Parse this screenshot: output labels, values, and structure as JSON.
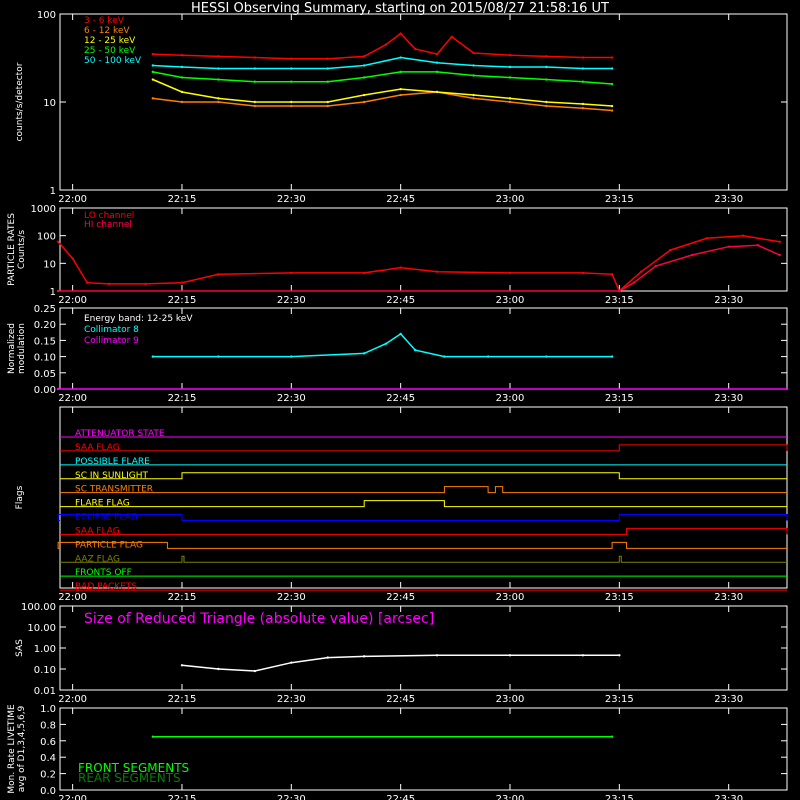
{
  "title": "HESSI Observing Summary, starting on 2015/08/27 21:58:16 UT",
  "time_ticks": [
    "22:00",
    "22:15",
    "22:30",
    "22:45",
    "23:00",
    "23:15",
    "23:30"
  ],
  "chart_data": [
    {
      "type": "line",
      "id": "count-rates",
      "ylabel": "counts/s/detector",
      "yscale": "log",
      "ylim": [
        1,
        100
      ],
      "ytick_labels": [
        "1",
        "10",
        "100"
      ],
      "x_range": [
        "21:58:16",
        "23:38:00"
      ],
      "series": [
        {
          "name": "3 - 6 keV",
          "color": "#ff0000",
          "x": [
            "22:11",
            "22:15",
            "22:20",
            "22:25",
            "22:30",
            "22:35",
            "22:40",
            "22:43",
            "22:45",
            "22:47",
            "22:50",
            "22:52",
            "22:55",
            "23:00",
            "23:05",
            "23:10",
            "23:14"
          ],
          "values": [
            35,
            34,
            33,
            32,
            31,
            31,
            33,
            45,
            60,
            40,
            35,
            55,
            36,
            34,
            33,
            32,
            32
          ]
        },
        {
          "name": "6 - 12 keV",
          "color": "#ff8000",
          "x": [
            "22:11",
            "22:15",
            "22:20",
            "22:25",
            "22:30",
            "22:35",
            "22:40",
            "22:45",
            "22:50",
            "22:55",
            "23:00",
            "23:05",
            "23:10",
            "23:14"
          ],
          "values": [
            11,
            10,
            10,
            9,
            9,
            9,
            10,
            12,
            13,
            11,
            10,
            9,
            8.5,
            8
          ]
        },
        {
          "name": "12 - 25 keV",
          "color": "#ffff00",
          "x": [
            "22:11",
            "22:15",
            "22:20",
            "22:25",
            "22:30",
            "22:35",
            "22:40",
            "22:45",
            "22:50",
            "22:55",
            "23:00",
            "23:05",
            "23:10",
            "23:14"
          ],
          "values": [
            18,
            13,
            11,
            10,
            10,
            10,
            12,
            14,
            13,
            12,
            11,
            10,
            9.5,
            9
          ]
        },
        {
          "name": "25 - 50 keV",
          "color": "#00ff00",
          "x": [
            "22:11",
            "22:15",
            "22:20",
            "22:25",
            "22:30",
            "22:35",
            "22:40",
            "22:45",
            "22:50",
            "22:55",
            "23:00",
            "23:05",
            "23:10",
            "23:14"
          ],
          "values": [
            22,
            19,
            18,
            17,
            17,
            17,
            19,
            22,
            22,
            20,
            19,
            18,
            17,
            16
          ]
        },
        {
          "name": "50 - 100 keV",
          "color": "#00ffff",
          "x": [
            "22:11",
            "22:15",
            "22:20",
            "22:25",
            "22:30",
            "22:35",
            "22:40",
            "22:45",
            "22:50",
            "22:55",
            "23:00",
            "23:05",
            "23:10",
            "23:14"
          ],
          "values": [
            26,
            25,
            24,
            24,
            24,
            24,
            26,
            32,
            28,
            26,
            25,
            25,
            24,
            24
          ]
        }
      ]
    },
    {
      "type": "line",
      "id": "particle-rates",
      "ylabel": "PARTICLE RATES",
      "ylabel2": "Counts/s",
      "yscale": "log",
      "ylim": [
        1,
        1000
      ],
      "ytick_labels": [
        "1",
        "10",
        "100",
        "1000"
      ],
      "series": [
        {
          "name": "LO channel",
          "color": "#ff0000",
          "x": [
            "21:58",
            "22:00",
            "22:02",
            "22:05",
            "22:10",
            "22:15",
            "22:20",
            "22:30",
            "22:40",
            "22:45",
            "22:50",
            "23:00",
            "23:10",
            "23:14",
            "23:15",
            "23:18",
            "23:22",
            "23:27",
            "23:32",
            "23:37"
          ],
          "values": [
            60,
            15,
            2,
            1.8,
            1.8,
            2,
            4,
            4.5,
            4.5,
            7,
            5,
            4.5,
            4.5,
            4,
            1,
            5,
            30,
            80,
            100,
            60
          ]
        },
        {
          "name": "HI channel",
          "color": "#ff0040",
          "x": [
            "21:58",
            "23:15",
            "23:17",
            "23:20",
            "23:25",
            "23:30",
            "23:34",
            "23:37"
          ],
          "values": [
            1,
            1,
            2,
            8,
            20,
            40,
            45,
            20
          ]
        }
      ]
    },
    {
      "type": "line",
      "id": "modulation",
      "ylabel": "Normalized",
      "ylabel2": "modulation",
      "ylim": [
        0,
        0.25
      ],
      "ytick_labels": [
        "0.00",
        "0.05",
        "0.10",
        "0.15",
        "0.20",
        "0.25"
      ],
      "annotation": "Energy band: 12-25 keV",
      "series": [
        {
          "name": "Collimator 8",
          "color": "#00ffff",
          "x": [
            "22:11",
            "22:20",
            "22:30",
            "22:40",
            "22:43",
            "22:45",
            "22:47",
            "22:51",
            "22:57",
            "23:05",
            "23:14"
          ],
          "values": [
            0.1,
            0.1,
            0.1,
            0.11,
            0.14,
            0.17,
            0.12,
            0.1,
            0.1,
            0.1,
            0.1
          ]
        },
        {
          "name": "Collimator 9",
          "color": "#ff00ff",
          "x": [
            "21:58",
            "23:38"
          ],
          "values": [
            0,
            0
          ]
        }
      ]
    },
    {
      "type": "line",
      "id": "flags",
      "ylabel": "Flags",
      "flags": [
        {
          "name": "ATTENUATOR STATE",
          "color": "#ff00ff",
          "on": []
        },
        {
          "name": "SAA FLAG",
          "color": "#ff0000",
          "on": [
            [
              "23:15",
              "23:38"
            ]
          ]
        },
        {
          "name": "POSSIBLE FLARE",
          "color": "#00ffff",
          "on": []
        },
        {
          "name": "SC IN SUNLIGHT",
          "color": "#ffff00",
          "on": [
            [
              "22:15",
              "23:15"
            ]
          ]
        },
        {
          "name": "SC TRANSMITTER",
          "color": "#ff8000",
          "on": [
            [
              "22:51",
              "22:57"
            ],
            [
              "22:58",
              "22:59"
            ]
          ]
        },
        {
          "name": "FLARE FLAG",
          "color": "#ffff00",
          "on": [
            [
              "22:40",
              "22:51"
            ]
          ]
        },
        {
          "name": "ECLIPSE FLAG",
          "color": "#0000ff",
          "on": [
            [
              "21:58",
              "22:15"
            ],
            [
              "23:15",
              "23:38"
            ]
          ]
        },
        {
          "name": "SAA FLAG",
          "color": "#ff0000",
          "on": [
            [
              "23:16",
              "23:38"
            ]
          ]
        },
        {
          "name": "PARTICLE FLAG",
          "color": "#ff8000",
          "on": [
            [
              "21:58",
              "22:13"
            ],
            [
              "23:14",
              "23:16"
            ]
          ]
        },
        {
          "name": "AAZ FLAG",
          "color": "#808000",
          "on": [
            [
              "22:15",
              "22:15"
            ],
            [
              "23:15",
              "23:15"
            ]
          ]
        },
        {
          "name": "FRONTS OFF",
          "color": "#00ff00",
          "on": []
        },
        {
          "name": "BAD PACKETS",
          "color": "#ff0000",
          "on": []
        }
      ]
    },
    {
      "type": "line",
      "id": "sas",
      "ylabel": "SAS",
      "yscale": "log",
      "ylim": [
        0.01,
        100
      ],
      "ytick_labels": [
        "0.01",
        "0.10",
        "1.00",
        "10.00",
        "100.00"
      ],
      "annotation": "Size of Reduced Triangle (absolute value) [arcsec]",
      "series": [
        {
          "name": "",
          "color": "#ffffff",
          "x": [
            "22:15",
            "22:20",
            "22:25",
            "22:30",
            "22:35",
            "22:40",
            "22:50",
            "23:00",
            "23:10",
            "23:15"
          ],
          "values": [
            0.15,
            0.1,
            0.08,
            0.2,
            0.35,
            0.4,
            0.45,
            0.45,
            0.45,
            0.45
          ]
        }
      ]
    },
    {
      "type": "line",
      "id": "livetime",
      "ylabel": "Mon. Rate LIVETIME",
      "ylabel2": "avg of D1,3,4,5,6,9",
      "ylim": [
        0,
        1
      ],
      "ytick_labels": [
        "0.0",
        "0.2",
        "0.4",
        "0.6",
        "0.8",
        "1.0"
      ],
      "series": [
        {
          "name": "FRONT SEGMENTS",
          "color": "#00ff00",
          "x": [
            "22:11",
            "23:14"
          ],
          "values": [
            0.65,
            0.65
          ]
        },
        {
          "name": "REAR SEGMENTS",
          "color": "#008000",
          "x": [],
          "values": []
        }
      ]
    }
  ]
}
